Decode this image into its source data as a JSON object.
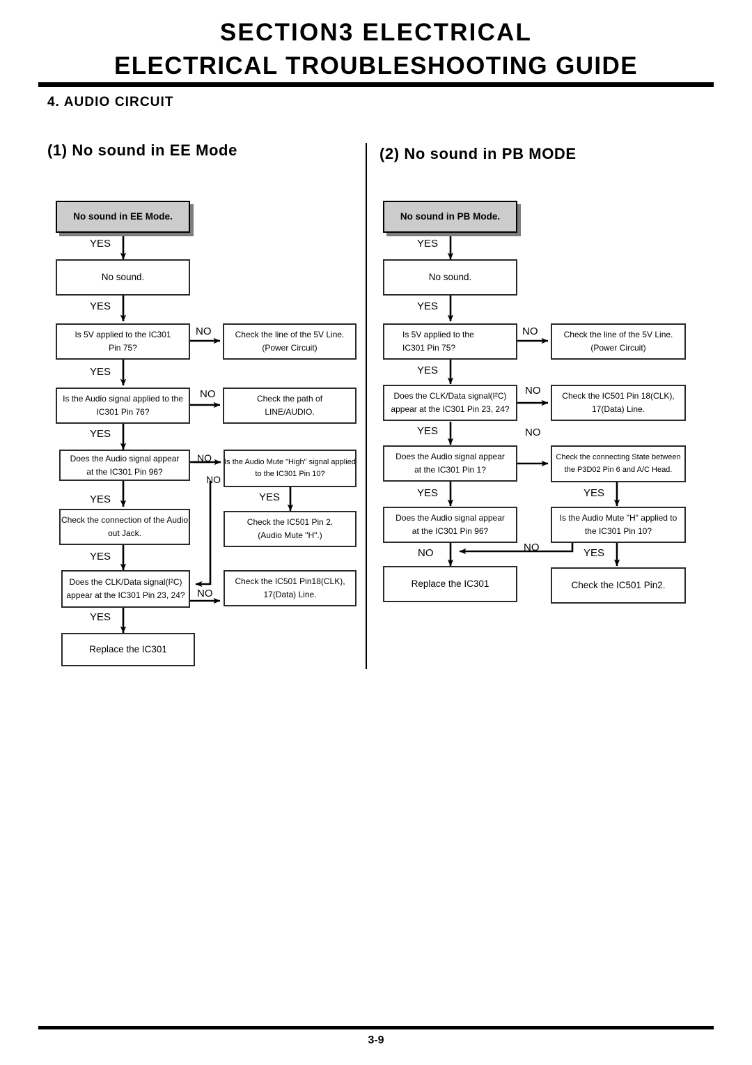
{
  "header": {
    "line1": "SECTION3   ELECTRICAL",
    "line2": "ELECTRICAL TROUBLESHOOTING GUIDE",
    "section_title": "4. AUDIO CIRCUIT"
  },
  "footer": {
    "page_number": "3-9"
  },
  "columns": [
    {
      "heading": "(1) No sound in EE Mode",
      "nodes": {
        "start": {
          "lines": [
            "No sound in EE Mode."
          ]
        },
        "no_sound": {
          "lines": [
            "No sound."
          ]
        },
        "q_5v": {
          "lines": [
            "Is 5V applied to the IC301",
            "Pin 75?"
          ]
        },
        "a_5v": {
          "lines": [
            "Check the line of the 5V Line.",
            "(Power Circuit)"
          ]
        },
        "q_audio_in": {
          "lines": [
            "Is the Audio signal applied to the",
            "IC301 Pin 76?"
          ]
        },
        "a_audio_in": {
          "lines": [
            "Check the path of",
            "LINE/AUDIO."
          ]
        },
        "q_pin96": {
          "lines": [
            "Does the Audio signal appear",
            "at the IC301 Pin 96?"
          ]
        },
        "q_mute": {
          "lines": [
            "Is the Audio Mute \"High\" signal applied",
            "to the IC301 Pin 10?"
          ]
        },
        "a_jack": {
          "lines": [
            "Check the connection of the Audio",
            "out Jack."
          ]
        },
        "a_mute": {
          "lines": [
            "Check the IC501 Pin 2.",
            "(Audio Mute \"H\".)"
          ]
        },
        "q_clk": {
          "lines": [
            "Does the CLK/Data signal(I²C)",
            "appear at the IC301 Pin 23, 24?"
          ]
        },
        "a_clk": {
          "lines": [
            "Check the IC501 Pin18(CLK),",
            "17(Data) Line."
          ]
        },
        "a_replace": {
          "lines": [
            "Replace the IC301"
          ]
        }
      },
      "edge_labels": [
        {
          "id": "yes-1",
          "text": "YES"
        },
        {
          "id": "yes-2",
          "text": "YES"
        },
        {
          "id": "no-5v",
          "text": "NO"
        },
        {
          "id": "yes-3",
          "text": "YES"
        },
        {
          "id": "no-audio-in",
          "text": "NO"
        },
        {
          "id": "yes-4",
          "text": "YES"
        },
        {
          "id": "no-pin96",
          "text": "NO"
        },
        {
          "id": "no-mute",
          "text": "NO"
        },
        {
          "id": "yes-5",
          "text": "YES"
        },
        {
          "id": "yes-mute",
          "text": "YES"
        },
        {
          "id": "yes-6",
          "text": "YES"
        },
        {
          "id": "no-clk",
          "text": "NO"
        },
        {
          "id": "yes-7",
          "text": "YES"
        }
      ]
    },
    {
      "heading": "(2) No sound in PB MODE",
      "nodes": {
        "start": {
          "lines": [
            "No sound in PB Mode."
          ]
        },
        "no_sound": {
          "lines": [
            "No sound."
          ]
        },
        "q_5v": {
          "lines": [
            "Is 5V applied to the",
            "IC301 Pin 75?"
          ]
        },
        "a_5v": {
          "lines": [
            "Check the line of the 5V Line.",
            "(Power Circuit)"
          ]
        },
        "q_clk": {
          "lines": [
            "Does the CLK/Data signal(I²C)",
            "appear at the IC301 Pin 23, 24?"
          ]
        },
        "a_clk": {
          "lines": [
            "Check the IC501 Pin 18(CLK),",
            "17(Data) Line."
          ]
        },
        "q_pin1": {
          "lines": [
            "Does the Audio signal appear",
            "at the IC301 Pin 1?"
          ]
        },
        "a_head": {
          "lines": [
            "Check the connecting State between",
            "the P3D02 Pin 6 and A/C Head."
          ]
        },
        "q_pin96": {
          "lines": [
            "Does the Audio signal appear",
            "at the  IC301 Pin 96?"
          ]
        },
        "q_mute": {
          "lines": [
            "Is the Audio Mute \"H\" applied to",
            "the  IC301 Pin 10?"
          ]
        },
        "a_replace": {
          "lines": [
            "Replace the IC301"
          ]
        },
        "a_ic501": {
          "lines": [
            "Check the IC501 Pin2."
          ]
        }
      },
      "edge_labels": [
        {
          "id": "yes-1",
          "text": "YES"
        },
        {
          "id": "yes-2",
          "text": "YES"
        },
        {
          "id": "no-5v",
          "text": "NO"
        },
        {
          "id": "yes-3",
          "text": "YES"
        },
        {
          "id": "no-clk",
          "text": "NO"
        },
        {
          "id": "yes-4",
          "text": "YES"
        },
        {
          "id": "no-pin1",
          "text": "NO"
        },
        {
          "id": "yes-5",
          "text": "YES"
        },
        {
          "id": "yes-head",
          "text": "YES"
        },
        {
          "id": "no-pin96",
          "text": "NO"
        },
        {
          "id": "no-mute",
          "text": "NO"
        },
        {
          "id": "yes-mute",
          "text": "YES"
        }
      ]
    }
  ]
}
